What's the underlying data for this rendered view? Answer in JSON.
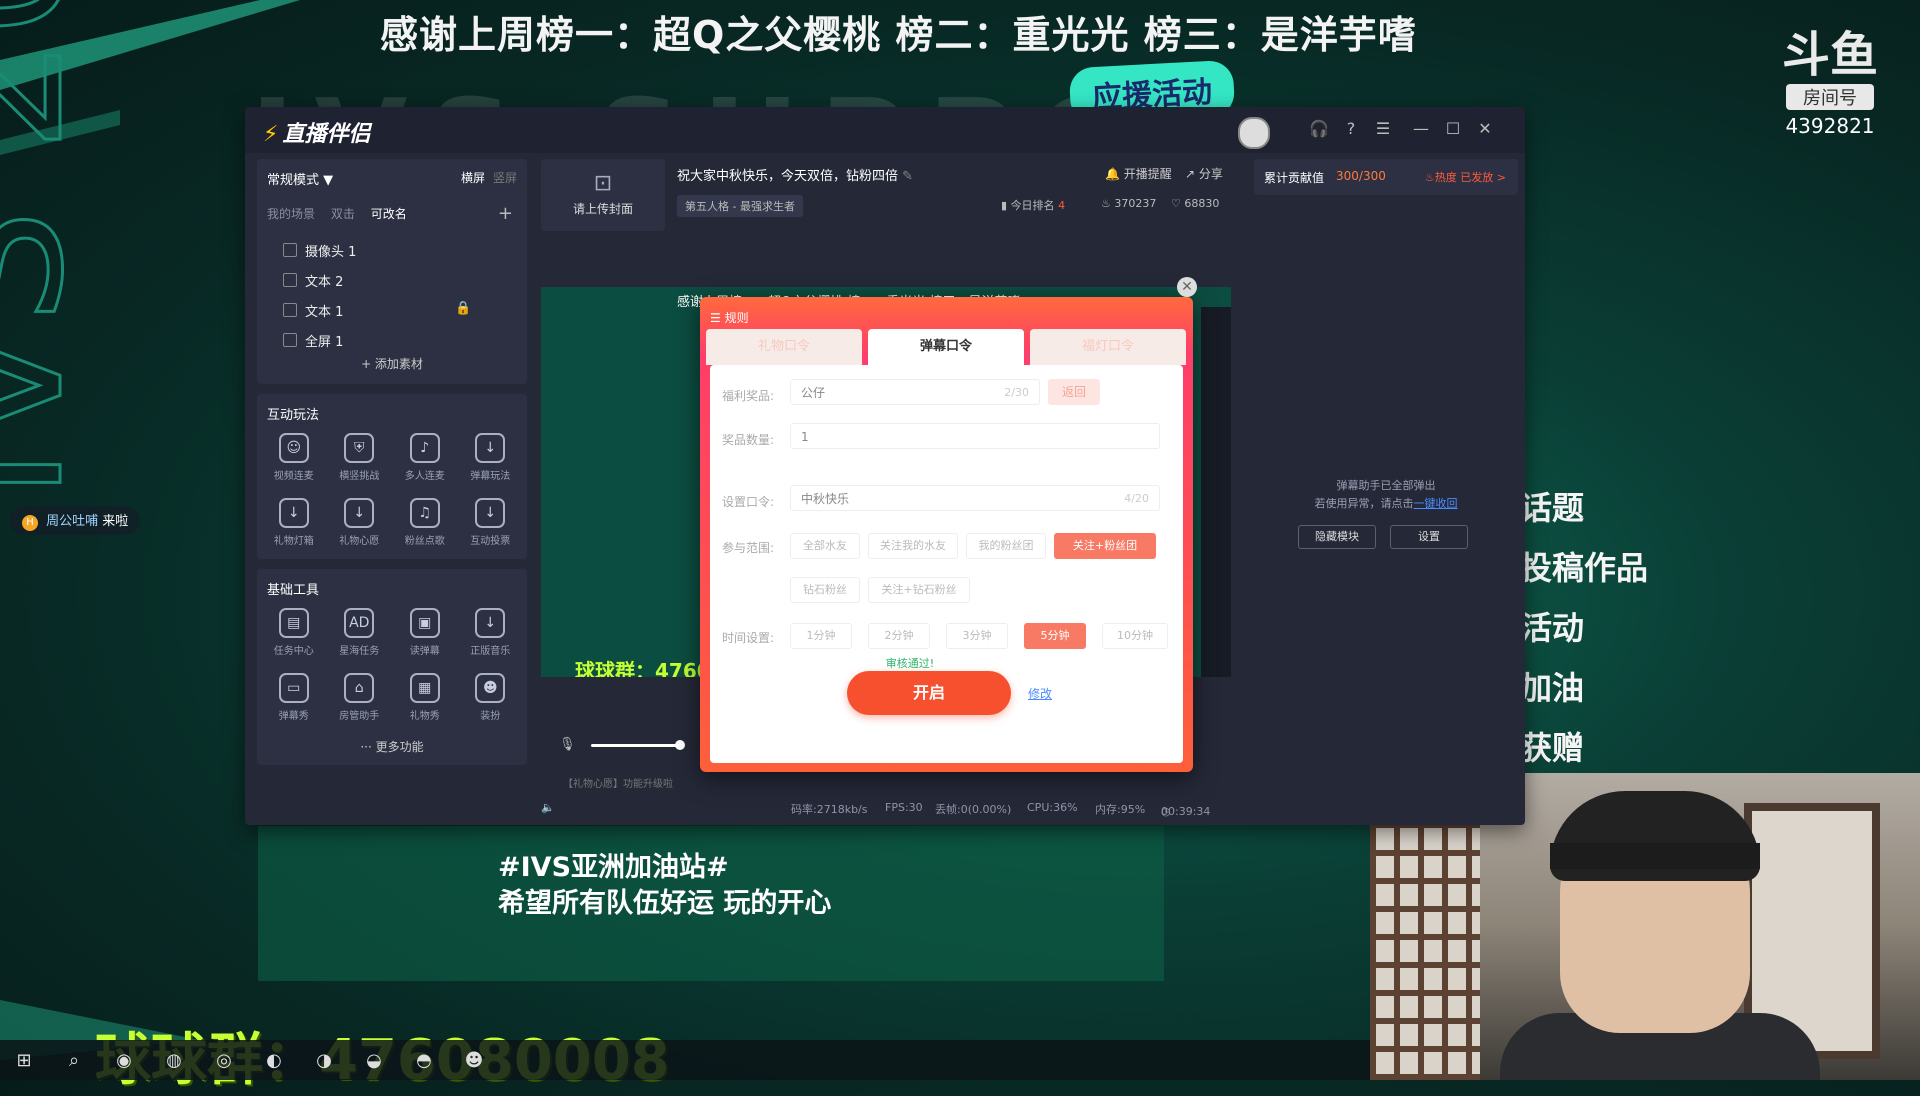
{
  "overlay": {
    "banner": "感谢上周榜一：超Q之父樱桃  榜二：重光光  榜三：是洋芋嗜",
    "watermark": "IVS SUPPOR",
    "support_badge": "应援活动",
    "douyu_mark": "斗鱼",
    "room_label": "房间号",
    "room_number": "4392821",
    "side_menu": [
      "话题",
      "投稿作品",
      "活动",
      "加油",
      "获赠"
    ],
    "hashtag_line1": "#IVS亚洲加油站#",
    "hashtag_line2": "希望所有队伍好运 玩的开心",
    "qq_group": "球球群：476080008",
    "chat_user": "周公吐哺",
    "chat_action": "来啦",
    "chat_badge": "H"
  },
  "app": {
    "logo": "直播伴侣",
    "mode": "常规模式",
    "orient_landscape": "横屏",
    "orient_portrait": "竖屏",
    "scene_tabs": [
      "我的场景",
      "双击",
      "可改名"
    ],
    "sources": [
      {
        "label": "摄像头 1"
      },
      {
        "label": "文本 2"
      },
      {
        "label": "文本 1"
      },
      {
        "label": "全屏 1"
      }
    ],
    "add_source": "+ 添加素材",
    "interactive_title": "互动玩法",
    "interactive_tools": [
      "视频连麦",
      "横竖挑战",
      "多人连麦",
      "弹幕玩法",
      "礼物灯箱",
      "礼物心愿",
      "粉丝点歌",
      "互动投票"
    ],
    "basic_title": "基础工具",
    "basic_tools": [
      "任务中心",
      "星海任务",
      "读弹幕",
      "正版音乐",
      "弹幕秀",
      "房管助手",
      "礼物秀",
      "装扮"
    ],
    "more": "··· 更多功能",
    "upload_cover": "请上传封面",
    "stream_title": "祝大家中秋快乐，今天双倍，钻粉四倍",
    "category": "第五人格 - 最强求生者",
    "notify": "开播提醒",
    "share": "分享",
    "rank_label": "今日排名",
    "rank_value": "4",
    "hot_value": "370237",
    "like_value": "68830",
    "preview_banner": "感谢上周榜一：超Q之父樱桃  榜二：重光光  榜三：是洋芋嗜",
    "preview_qq": "球球群：4760",
    "status": {
      "bitrate": "码率:2718kb/s",
      "fps": "FPS:30",
      "drop": "丢帧:0(0.00%)",
      "cpu": "CPU:36%",
      "mem": "内存:95%",
      "time": "00:39:34"
    },
    "audio_note": "【礼物心愿】功能升级啦",
    "contrib_label": "累计贡献值",
    "contrib_value": "300/300",
    "hot_tag": "热度",
    "sent_tag": "已发放 >",
    "assist_line1": "弹幕助手已全部弹出",
    "assist_line2": "若使用异常，请点击",
    "assist_link": "一键收回",
    "hide_module": "隐藏模块",
    "settings": "设置"
  },
  "modal": {
    "rules": "规则",
    "tabs": [
      "礼物口令",
      "弹幕口令",
      "福灯口令"
    ],
    "active_tab": 1,
    "prize_label": "福利奖品:",
    "prize_value": "公仔",
    "prize_count": "2/30",
    "back": "返回",
    "qty_label": "奖品数量:",
    "qty_value": "1",
    "code_label": "设置口令:",
    "code_value": "中秋快乐",
    "code_count": "4/20",
    "scope_label": "参与范围:",
    "scope_options": [
      "全部水友",
      "关注我的水友",
      "我的粉丝团",
      "关注+粉丝团",
      "钻石粉丝",
      "关注+钻石粉丝"
    ],
    "scope_selected": 3,
    "time_label": "时间设置:",
    "time_options": [
      "1分钟",
      "2分钟",
      "3分钟",
      "5分钟",
      "10分钟"
    ],
    "time_selected": 3,
    "pass_text": "审核通过!",
    "start": "开启",
    "edit": "修改"
  },
  "colors": {
    "accent": "#f6502e",
    "app_bg": "#252837",
    "qq_green": "#c6ff33",
    "badge_teal": "#35e6c4"
  }
}
